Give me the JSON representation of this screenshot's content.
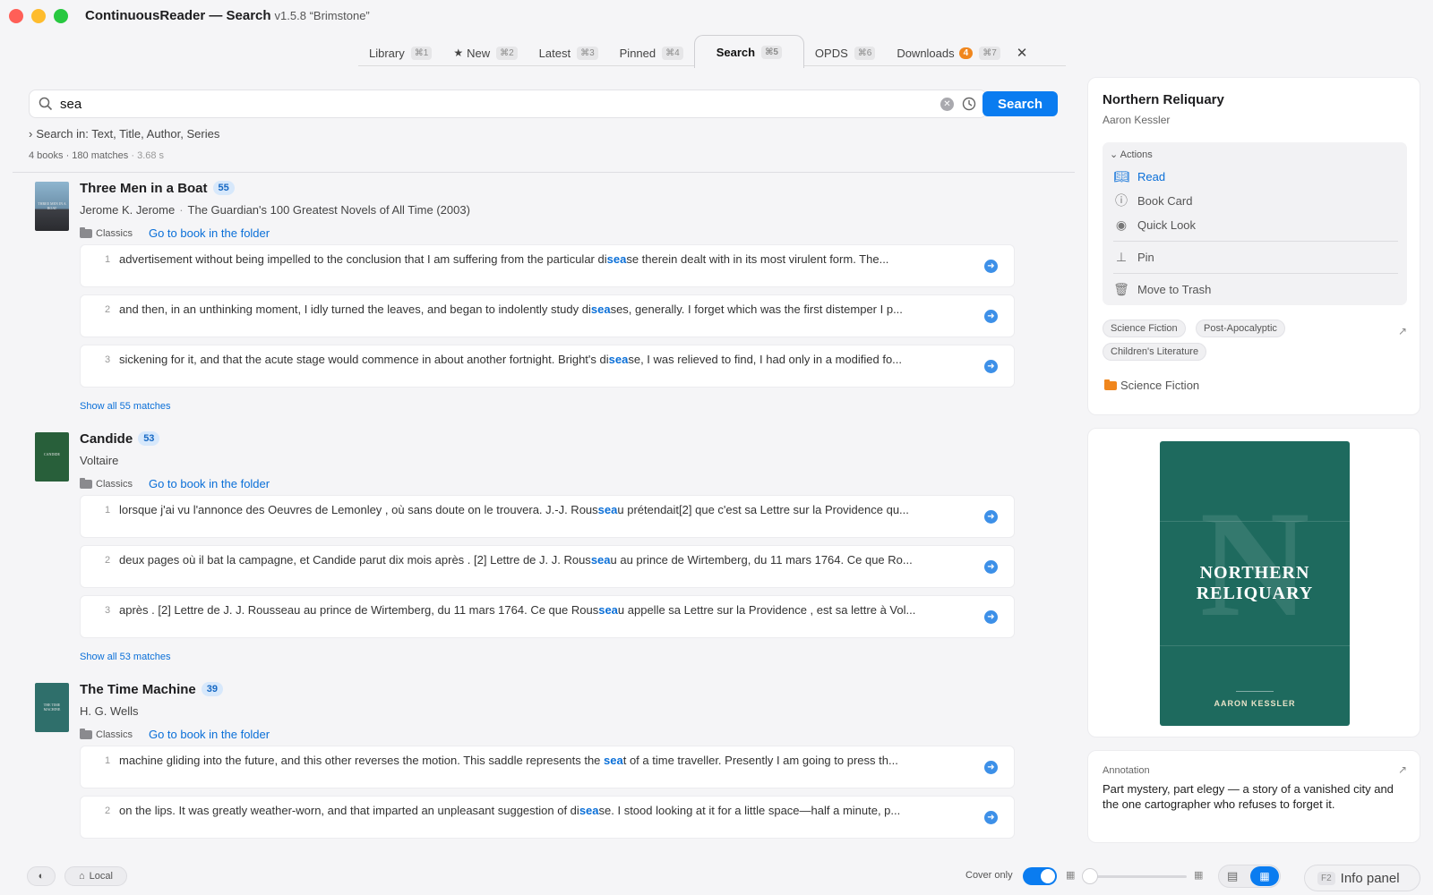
{
  "window": {
    "title": "ContinuousReader — Search",
    "version": "v1.5.8 “Brimstone”"
  },
  "tabs": [
    {
      "label": "Library",
      "shortcut": "⌘1"
    },
    {
      "label": "New",
      "shortcut": "⌘2"
    },
    {
      "label": "Latest",
      "shortcut": "⌘3"
    },
    {
      "label": "Pinned",
      "shortcut": "⌘4"
    },
    {
      "label": "Search",
      "shortcut": "⌘5"
    },
    {
      "label": "OPDS",
      "shortcut": "⌘6"
    },
    {
      "label": "Downloads",
      "shortcut": "⌘7",
      "badge": "4"
    }
  ],
  "search": {
    "query": "sea",
    "button_label": "Search",
    "search_in": "Search in: Text, Title, Author, Series",
    "summary": "4 books · 180 matches",
    "time": "· 3.68 s"
  },
  "results": [
    {
      "title": "Three Men in a Boat",
      "count": "55",
      "author": "Jerome K. Jerome",
      "collection": "The Guardian's 100 Greatest Novels of All Time (2003)",
      "folder": "Classics",
      "goto": "Go to book in the folder",
      "cover_text": "THREE MEN IN A BOAT",
      "matches": [
        {
          "n": "1",
          "pre": "advertisement without being impelled to the conclusion that I am suffering from the particular di",
          "hl": "sea",
          "post": "se therein dealt with in its most virulent form. The..."
        },
        {
          "n": "2",
          "pre": "and then, in an unthinking moment, I idly turned the leaves, and began to indolently study di",
          "hl": "sea",
          "post": "ses, generally. I forget which was the first distemper I p..."
        },
        {
          "n": "3",
          "pre": "sickening for it, and that the acute stage would commence in about another fortnight. Bright's di",
          "hl": "sea",
          "post": "se, I was relieved to find, I had only in a modified fo..."
        }
      ],
      "show_all": "Show all 55 matches"
    },
    {
      "title": "Candide",
      "count": "53",
      "author": "Voltaire",
      "folder": "Classics",
      "goto": "Go to book in the folder",
      "cover_text": "CANDIDE",
      "matches": [
        {
          "n": "1",
          "pre": "lorsque j'ai vu l'annonce des Oeuvres de Lemonley , où sans doute on le trouvera. J.-J. Rous",
          "hl": "sea",
          "post": "u prétendait[2] que c'est sa Lettre sur la Providence qu..."
        },
        {
          "n": "2",
          "pre": "deux pages où il bat la campagne, et Candide parut dix mois après . [2] Lettre de J. J. Rous",
          "hl": "sea",
          "post": "u au prince de Wirtemberg, du 11 mars 1764. Ce que Ro..."
        },
        {
          "n": "3",
          "pre": "après . [2] Lettre de J. J. Rousseau au prince de Wirtemberg, du 11 mars 1764. Ce que Rous",
          "hl": "sea",
          "post": "u appelle sa Lettre sur la Providence , est sa lettre à Vol..."
        }
      ],
      "show_all": "Show all 53 matches"
    },
    {
      "title": "The Time Machine",
      "count": "39",
      "author": "H. G. Wells",
      "folder": "Classics",
      "goto": "Go to book in the folder",
      "cover_text": "THE TIME MACHINE",
      "matches": [
        {
          "n": "1",
          "pre": "machine gliding into the future, and this other reverses the motion. This saddle represents the ",
          "hl": "sea",
          "post": "t of a time traveller. Presently I am going to press th..."
        },
        {
          "n": "2",
          "pre": "on the lips. It was greatly weather-worn, and that imparted an unpleasant suggestion of di",
          "hl": "sea",
          "post": "se. I stood looking at it for a little space—half a minute, p..."
        }
      ]
    }
  ],
  "info": {
    "title": "Northern Reliquary",
    "author": "Aaron Kessler",
    "actions_header": "Actions",
    "actions": [
      {
        "label": "Read",
        "icon": "book-open-icon"
      },
      {
        "label": "Book Card",
        "icon": "info-circle-icon"
      },
      {
        "label": "Quick Look",
        "icon": "eye-icon"
      },
      {
        "label": "Pin",
        "icon": "pin-icon"
      },
      {
        "label": "Move to Trash",
        "icon": "trash-icon"
      }
    ],
    "tags": [
      "Science Fiction",
      "Post-Apocalyptic",
      "Children's Literature"
    ],
    "genre": "Science Fiction",
    "cover_title_line1": "NORTHERN",
    "cover_title_line2": "RELIQUARY",
    "cover_author": "AARON KESSLER",
    "cover_letter": "N",
    "annotation_header": "Annotation",
    "annotation": "Part mystery, part elegy — a story of a vanished city and the one cartographer who refuses to forget it."
  },
  "bottom": {
    "storage": "Local",
    "cover_only": "Cover only",
    "info_panel_key": "F2",
    "info_panel": "Info panel"
  },
  "colors": {
    "accent": "#0a7cf0",
    "badge": "#f0861d",
    "cover_green": "#1e6a5e"
  }
}
